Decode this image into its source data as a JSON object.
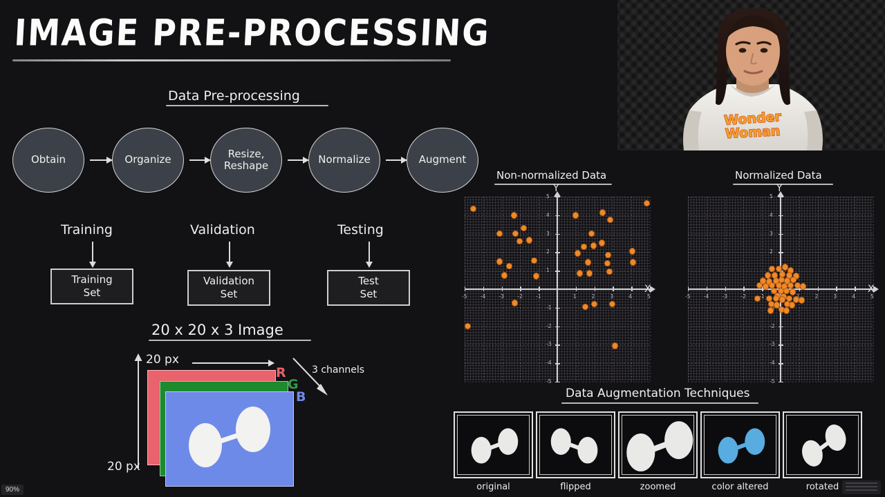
{
  "slide": {
    "title": "IMAGE PRE-PROCESSING",
    "background_color": "#121114",
    "ink_color": "#f2f2f0"
  },
  "pipeline": {
    "heading": "Data Pre-processing",
    "nodes": [
      {
        "label": "Obtain"
      },
      {
        "label": "Organize"
      },
      {
        "label_line1": "Resize,",
        "label_line2": "Reshape"
      },
      {
        "label": "Normalize"
      },
      {
        "label": "Augment"
      }
    ]
  },
  "splits": [
    {
      "arrow_label": "Training",
      "box_line1": "Training",
      "box_line2": "Set"
    },
    {
      "arrow_label": "Validation",
      "box_line1": "Validation",
      "box_line2": "Set"
    },
    {
      "arrow_label": "Testing",
      "box_line1": "Test",
      "box_line2": "Set"
    }
  ],
  "image_tensor": {
    "heading": "20 x 20 x 3 Image",
    "width_label": "20 px",
    "height_label": "20 px",
    "channels_label": "3 channels",
    "channels": [
      {
        "letter": "R",
        "color": "#e8636b"
      },
      {
        "letter": "G",
        "color": "#1d8a2e"
      },
      {
        "letter": "B",
        "color": "#6e8ae8"
      }
    ]
  },
  "chart_data": [
    {
      "type": "scatter",
      "title": "Non-normalized Data",
      "xlabel": "X",
      "ylabel": "Y",
      "xlim": [
        -5,
        5
      ],
      "ylim": [
        -5,
        5
      ],
      "xticks": [
        -5,
        -4,
        -3,
        -2,
        -1,
        1,
        2,
        3,
        4,
        5
      ],
      "yticks": [
        -5,
        -4,
        -3,
        -2,
        -1,
        1,
        2,
        3,
        4,
        5
      ],
      "grid": true,
      "marker_color": "#ef8a29",
      "points": [
        [
          -4.55,
          4.35
        ],
        [
          -2.35,
          4.0
        ],
        [
          -3.1,
          3.0
        ],
        [
          -2.25,
          3.0
        ],
        [
          -1.8,
          3.3
        ],
        [
          -2.05,
          2.6
        ],
        [
          -1.5,
          2.65
        ],
        [
          -3.1,
          1.5
        ],
        [
          -2.6,
          1.25
        ],
        [
          -1.25,
          1.55
        ],
        [
          -2.85,
          0.75
        ],
        [
          -1.15,
          0.7
        ],
        [
          -2.3,
          -0.75
        ],
        [
          -4.85,
          -2.0
        ],
        [
          1.0,
          4.0
        ],
        [
          2.45,
          4.15
        ],
        [
          2.85,
          3.75
        ],
        [
          1.85,
          3.0
        ],
        [
          1.45,
          2.3
        ],
        [
          1.95,
          2.35
        ],
        [
          2.4,
          2.5
        ],
        [
          1.1,
          1.95
        ],
        [
          2.75,
          1.85
        ],
        [
          1.65,
          1.45
        ],
        [
          2.7,
          1.4
        ],
        [
          1.2,
          0.85
        ],
        [
          1.75,
          0.85
        ],
        [
          2.8,
          0.95
        ],
        [
          4.05,
          2.05
        ],
        [
          4.1,
          1.45
        ],
        [
          4.85,
          4.65
        ],
        [
          1.5,
          -0.95
        ],
        [
          2.0,
          -0.8
        ],
        [
          2.95,
          -0.8
        ],
        [
          3.1,
          -3.05
        ]
      ]
    },
    {
      "type": "scatter",
      "title": "Normalized Data",
      "xlabel": "X",
      "ylabel": "Y",
      "xlim": [
        -5,
        5
      ],
      "ylim": [
        -5,
        5
      ],
      "xticks": [
        -5,
        -4,
        -3,
        -2,
        -1,
        1,
        2,
        3,
        4,
        5
      ],
      "yticks": [
        -5,
        -4,
        -3,
        -2,
        -1,
        1,
        2,
        3,
        4,
        5
      ],
      "grid": true,
      "marker_color": "#ef8a29",
      "points": [
        [
          -0.45,
          1.1
        ],
        [
          -0.1,
          1.1
        ],
        [
          0.25,
          1.2
        ],
        [
          0.55,
          1.0
        ],
        [
          -0.7,
          0.75
        ],
        [
          -0.3,
          0.75
        ],
        [
          0.1,
          0.8
        ],
        [
          0.45,
          0.75
        ],
        [
          0.85,
          0.7
        ],
        [
          -0.95,
          0.45
        ],
        [
          -0.6,
          0.4
        ],
        [
          -0.25,
          0.45
        ],
        [
          0.05,
          0.5
        ],
        [
          0.35,
          0.45
        ],
        [
          0.7,
          0.5
        ],
        [
          -1.15,
          0.2
        ],
        [
          -0.8,
          0.15
        ],
        [
          -0.45,
          0.2
        ],
        [
          -0.1,
          0.2
        ],
        [
          0.2,
          0.15
        ],
        [
          0.55,
          0.2
        ],
        [
          0.9,
          0.2
        ],
        [
          1.2,
          0.15
        ],
        [
          -0.35,
          -0.1
        ],
        [
          0.0,
          -0.1
        ],
        [
          0.3,
          -0.1
        ],
        [
          0.65,
          -0.15
        ],
        [
          -0.15,
          -0.35
        ],
        [
          0.15,
          -0.4
        ],
        [
          -0.6,
          -0.5
        ],
        [
          -0.25,
          -0.5
        ],
        [
          0.1,
          -0.55
        ],
        [
          0.45,
          -0.5
        ],
        [
          -1.25,
          -0.5
        ],
        [
          0.85,
          -0.55
        ],
        [
          1.15,
          -0.6
        ],
        [
          -0.5,
          -0.8
        ],
        [
          -0.2,
          -0.85
        ],
        [
          0.35,
          -0.8
        ],
        [
          0.6,
          -0.85
        ],
        [
          -0.55,
          -1.15
        ],
        [
          0.05,
          -1.1
        ],
        [
          0.3,
          -1.15
        ]
      ]
    }
  ],
  "augmentation": {
    "heading": "Data Augmentation Techniques",
    "items": [
      {
        "caption": "original",
        "variant": "original",
        "shape_color": "#e9e9e7"
      },
      {
        "caption": "flipped",
        "variant": "flipped",
        "shape_color": "#e9e9e7"
      },
      {
        "caption": "zoomed",
        "variant": "zoomed",
        "shape_color": "#e9e9e7"
      },
      {
        "caption": "color altered",
        "variant": "color-altered",
        "shape_color": "#58ace0"
      },
      {
        "caption": "rotated",
        "variant": "rotated",
        "shape_color": "#e9e9e7"
      }
    ]
  },
  "video_overlay": {
    "description": "presenter video",
    "shirt_text_line1": "Wonder",
    "shirt_text_line2": "Woman"
  },
  "player": {
    "zoom_level": "90%"
  }
}
